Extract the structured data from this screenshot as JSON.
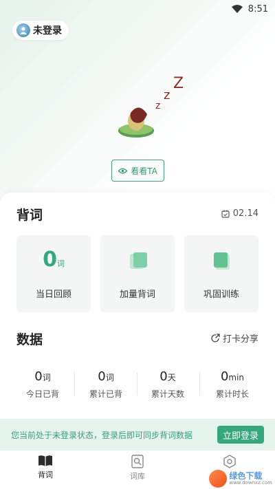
{
  "status_bar": {
    "time": "8:51",
    "wifi_icon": "wifi-icon"
  },
  "profile": {
    "login_label": "未登录",
    "avatar_icon": "avatar-icon"
  },
  "hero": {
    "mascot_icon": "sleeping-bean-mascot-icon",
    "watch_button_label": "看看TA",
    "watch_icon": "eye-icon"
  },
  "recite": {
    "title": "背词",
    "date": "02.14",
    "calendar_icon": "calendar-icon",
    "tiles": [
      {
        "value": "0",
        "unit": "词",
        "label": "当日回顾"
      },
      {
        "label": "加量背词",
        "icon": "add-cards-icon"
      },
      {
        "label": "巩固训练",
        "icon": "review-cards-icon"
      }
    ]
  },
  "stats": {
    "title": "数据",
    "share_label": "打卡分享",
    "share_icon": "share-icon",
    "items": [
      {
        "value": "0",
        "unit": "词",
        "label": "今日已背"
      },
      {
        "value": "0",
        "unit": "词",
        "label": "累计已背"
      },
      {
        "value": "0",
        "unit": "天",
        "label": "累计天数"
      },
      {
        "value": "0",
        "unit": "min",
        "label": "累计时长"
      }
    ]
  },
  "banner": {
    "message": "您当前处于未登录状态，登录后即可同步背词数据",
    "login_button": "立即登录"
  },
  "tabbar": {
    "tabs": [
      {
        "label": "背词",
        "icon": "book-icon",
        "active": true
      },
      {
        "label": "词库",
        "icon": "word-bank-icon",
        "active": false
      },
      {
        "label": "",
        "icon": "settings-hex-icon",
        "active": false
      }
    ]
  },
  "watermark": {
    "text": "绿色下载",
    "sub": "www.downxz.com"
  },
  "colors": {
    "accent": "#36a77a",
    "banner_bg": "#e6f4ee",
    "tile_bg": "#f4f5f5"
  }
}
